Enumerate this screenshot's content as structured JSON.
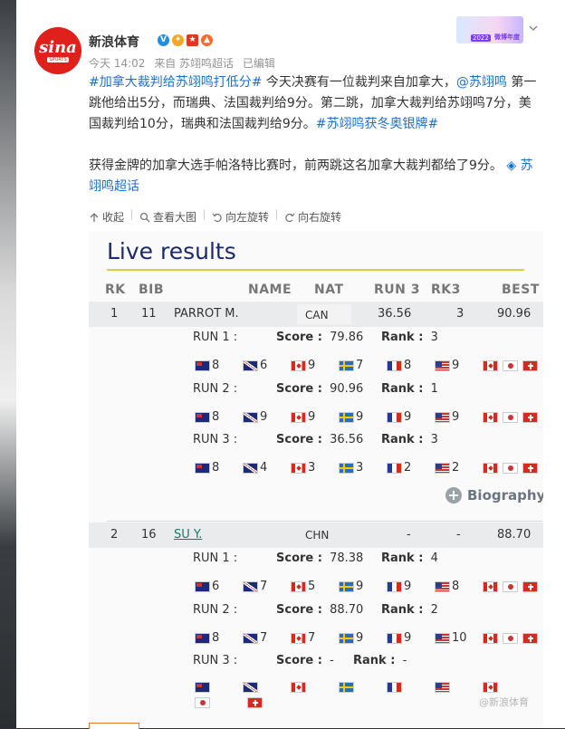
{
  "post": {
    "author": "新浪体育",
    "avatar_text": "sina",
    "avatar_sub": "SPORTS",
    "meta": [
      "今天 14:02",
      "来自 苏翊鸣超话",
      "已编辑"
    ],
    "banner_year": "2022",
    "banner_text": "微博年度",
    "para1_parts": [
      {
        "t": "#加拿大裁判给苏翊鸣打低分#",
        "link": true
      },
      {
        "t": " 今天决赛有一位裁判来自加拿大，",
        "link": false
      },
      {
        "t": "@苏翊鸣",
        "link": true
      },
      {
        "t": " 第一跳他给出5分，而瑞典、法国裁判给9分。第二跳，加拿大裁判给苏翊鸣7分，美国裁判给10分，瑞典和法国裁判给9分。",
        "link": false
      },
      {
        "t": "#苏翊鸣获冬奥银牌#",
        "link": true
      }
    ],
    "para2_text": "获得金牌的加拿大选手帕洛特比赛时，前两跳这名加拿大裁判都给了9分。",
    "para2_link": "◈ 苏翊鸣超话"
  },
  "toolbar": {
    "collapse": "收起",
    "view_large": "查看大图",
    "rotate_left": "向左旋转",
    "rotate_right": "向右旋转"
  },
  "results": {
    "title": "Live results",
    "headers": {
      "rk": "RK",
      "bib": "BIB",
      "name": "NAME",
      "nat": "NAT",
      "run3": "RUN 3",
      "rk3": "RK3",
      "best": "BEST"
    },
    "score_label": "Score :",
    "rank_label": "Rank :",
    "biography": "Biography",
    "athletes": [
      {
        "rk": "1",
        "bib": "11",
        "name": "PARROT M.",
        "nat": "CAN",
        "run3": "36.56",
        "rk3": "3",
        "best": "90.96",
        "runs": [
          {
            "label": "RUN 1 :",
            "score": "79.86",
            "rank": "3",
            "judges": [
              "8",
              "6",
              "9",
              "7",
              "8",
              "9"
            ]
          },
          {
            "label": "RUN 2 :",
            "score": "90.96",
            "rank": "1",
            "judges": [
              "8",
              "9",
              "9",
              "9",
              "9",
              "9"
            ]
          },
          {
            "label": "RUN 3 :",
            "score": "36.56",
            "rank": "3",
            "judges": [
              "8",
              "4",
              "3",
              "3",
              "2",
              "2"
            ]
          }
        ]
      },
      {
        "rk": "2",
        "bib": "16",
        "name": "SU Y.",
        "nat": "CHN",
        "run3": "-",
        "rk3": "-",
        "best": "88.70",
        "runs": [
          {
            "label": "RUN 1 :",
            "score": "78.38",
            "rank": "4",
            "judges": [
              "6",
              "7",
              "5",
              "9",
              "9",
              "8"
            ]
          },
          {
            "label": "RUN 2 :",
            "score": "88.70",
            "rank": "2",
            "judges": [
              "8",
              "7",
              "7",
              "9",
              "9",
              "10"
            ]
          },
          {
            "label": "RUN 3 :",
            "score": "-",
            "rank": "-",
            "judges": [
              "",
              "",
              "",
              "",
              "",
              ""
            ]
          }
        ]
      }
    ],
    "watermark": "@新浪体育"
  }
}
